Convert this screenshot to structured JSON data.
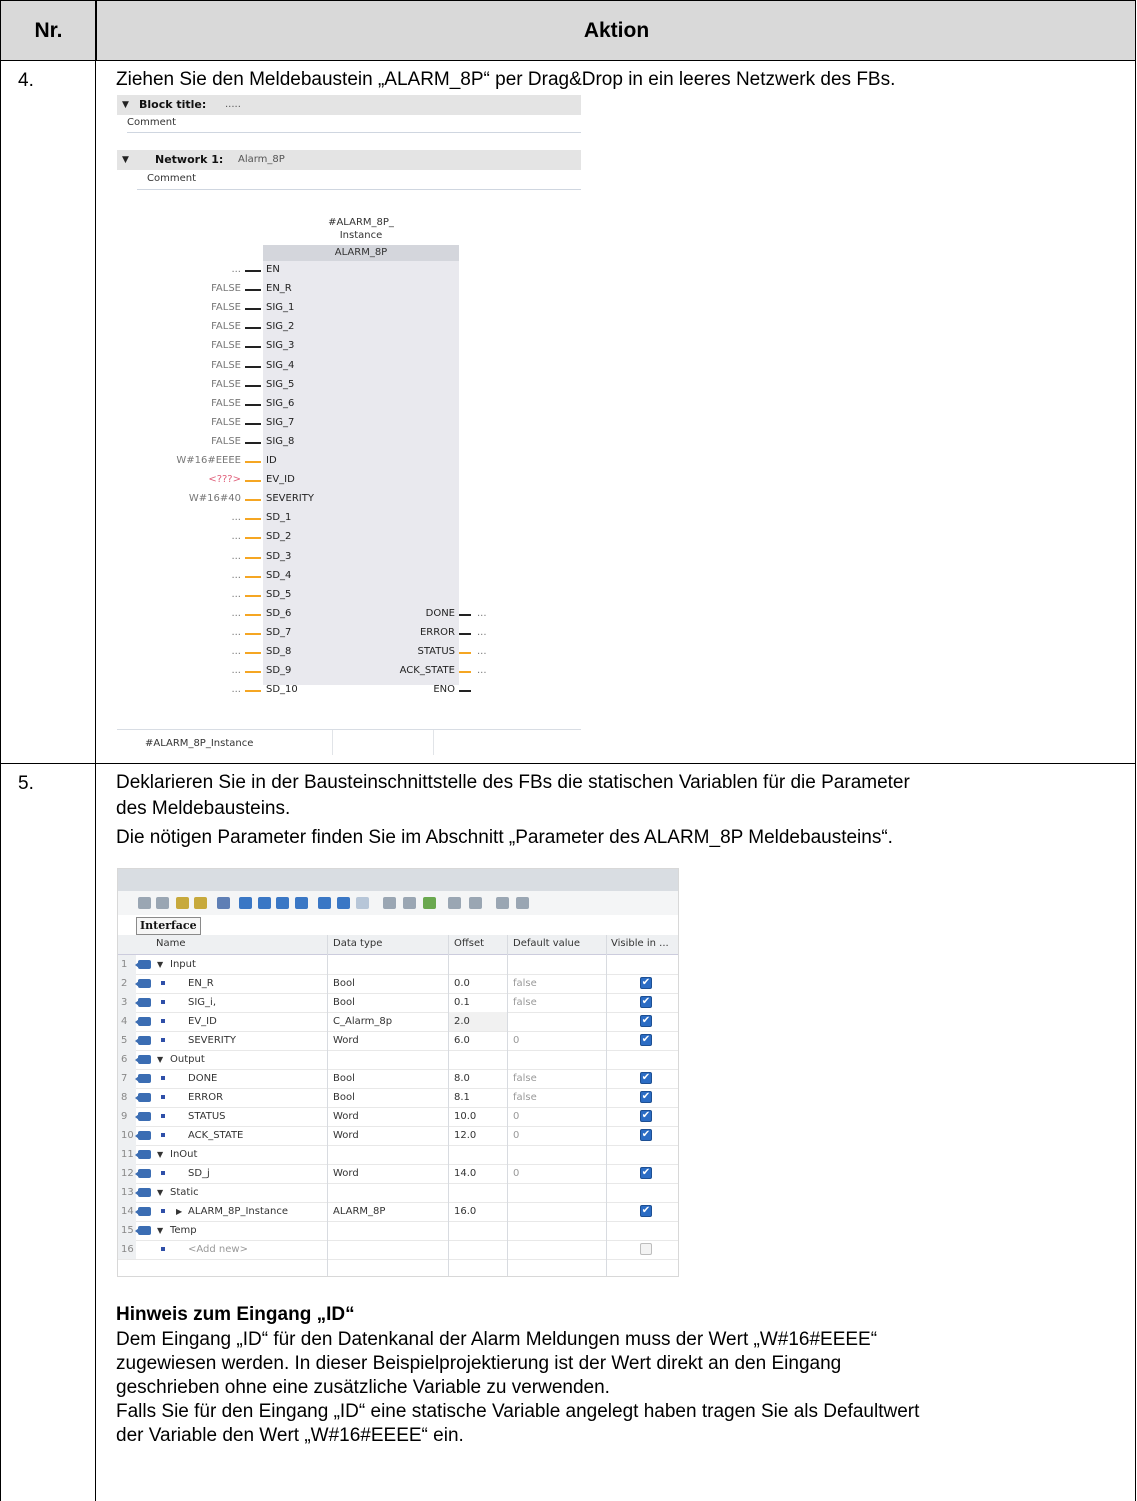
{
  "table": {
    "header_nr": "Nr.",
    "header_action": "Aktion"
  },
  "step4": {
    "nr": "4.",
    "text": "Ziehen Sie den Meldebaustein „ALARM_8P“ per Drag&Drop in ein leeres Netzwerk des FBs.",
    "editor": {
      "block_title_label": "Block title:",
      "block_title_value": ".....",
      "comment1": "Comment",
      "network_label": "Network 1:",
      "network_name": "Alarm_8P",
      "comment2": "Comment",
      "instance_line1": "#ALARM_8P_",
      "instance_line2": "Instance",
      "block_name": "ALARM_8P",
      "inputs": [
        {
          "value": "...",
          "pin": "EN",
          "wire": "black"
        },
        {
          "value": "FALSE",
          "pin": "EN_R",
          "wire": "black"
        },
        {
          "value": "FALSE",
          "pin": "SIG_1",
          "wire": "black"
        },
        {
          "value": "FALSE",
          "pin": "SIG_2",
          "wire": "black"
        },
        {
          "value": "FALSE",
          "pin": "SIG_3",
          "wire": "black"
        },
        {
          "value": "FALSE",
          "pin": "SIG_4",
          "wire": "black"
        },
        {
          "value": "FALSE",
          "pin": "SIG_5",
          "wire": "black"
        },
        {
          "value": "FALSE",
          "pin": "SIG_6",
          "wire": "black"
        },
        {
          "value": "FALSE",
          "pin": "SIG_7",
          "wire": "black"
        },
        {
          "value": "FALSE",
          "pin": "SIG_8",
          "wire": "black"
        },
        {
          "value": "W#16#EEEE",
          "pin": "ID",
          "wire": "orange"
        },
        {
          "value": "<???>",
          "pin": "EV_ID",
          "wire": "orange"
        },
        {
          "value": "W#16#40",
          "pin": "SEVERITY",
          "wire": "orange"
        },
        {
          "value": "...",
          "pin": "SD_1",
          "wire": "orange"
        },
        {
          "value": "...",
          "pin": "SD_2",
          "wire": "orange"
        },
        {
          "value": "...",
          "pin": "SD_3",
          "wire": "orange"
        },
        {
          "value": "...",
          "pin": "SD_4",
          "wire": "orange"
        },
        {
          "value": "...",
          "pin": "SD_5",
          "wire": "orange"
        },
        {
          "value": "...",
          "pin": "SD_6",
          "wire": "orange"
        },
        {
          "value": "...",
          "pin": "SD_7",
          "wire": "orange"
        },
        {
          "value": "...",
          "pin": "SD_8",
          "wire": "orange"
        },
        {
          "value": "...",
          "pin": "SD_9",
          "wire": "orange"
        },
        {
          "value": "...",
          "pin": "SD_10",
          "wire": "orange"
        }
      ],
      "outputs": [
        {
          "pin": "DONE",
          "value": "...",
          "wire": "black"
        },
        {
          "pin": "ERROR",
          "value": "...",
          "wire": "black"
        },
        {
          "pin": "STATUS",
          "value": "...",
          "wire": "orange"
        },
        {
          "pin": "ACK_STATE",
          "value": "...",
          "wire": "orange"
        },
        {
          "pin": "ENO",
          "value": "",
          "wire": "black"
        }
      ],
      "footer_instance": "#ALARM_8P_Instance"
    }
  },
  "step5": {
    "nr": "5.",
    "text1": "Deklarieren Sie in der Bausteinschnittstelle des FBs die statischen Variablen für die Parameter",
    "text2": "des Meldebausteins.",
    "text3": "Die nötigen Parameter finden Sie im Abschnitt „Parameter des ALARM_8P Meldebausteins“.",
    "interface": {
      "tab": "Interface",
      "columns": [
        "Name",
        "Data type",
        "Offset",
        "Default value",
        "Visible in ..."
      ],
      "rows": [
        {
          "n": "1",
          "level": 0,
          "toggle": "▼",
          "name": "Input",
          "type": "",
          "offset": "",
          "default": "",
          "visible": null
        },
        {
          "n": "2",
          "level": 1,
          "toggle": "",
          "name": "EN_R",
          "type": "Bool",
          "offset": "0.0",
          "default": "false",
          "visible": true
        },
        {
          "n": "3",
          "level": 1,
          "toggle": "",
          "name": "SIG_i,",
          "type": "Bool",
          "offset": "0.1",
          "default": "false",
          "visible": true
        },
        {
          "n": "4",
          "level": 1,
          "toggle": "",
          "name": "EV_ID",
          "type": "C_Alarm_8p",
          "offset": "2.0",
          "default": "",
          "visible": true,
          "shaded": true
        },
        {
          "n": "5",
          "level": 1,
          "toggle": "",
          "name": "SEVERITY",
          "type": "Word",
          "offset": "6.0",
          "default": "0",
          "visible": true
        },
        {
          "n": "6",
          "level": 0,
          "toggle": "▼",
          "name": "Output",
          "type": "",
          "offset": "",
          "default": "",
          "visible": null
        },
        {
          "n": "7",
          "level": 1,
          "toggle": "",
          "name": "DONE",
          "type": "Bool",
          "offset": "8.0",
          "default": "false",
          "visible": true
        },
        {
          "n": "8",
          "level": 1,
          "toggle": "",
          "name": "ERROR",
          "type": "Bool",
          "offset": "8.1",
          "default": "false",
          "visible": true
        },
        {
          "n": "9",
          "level": 1,
          "toggle": "",
          "name": "STATUS",
          "type": "Word",
          "offset": "10.0",
          "default": "0",
          "visible": true
        },
        {
          "n": "10",
          "level": 1,
          "toggle": "",
          "name": "ACK_STATE",
          "type": "Word",
          "offset": "12.0",
          "default": "0",
          "visible": true
        },
        {
          "n": "11",
          "level": 0,
          "toggle": "▼",
          "name": "InOut",
          "type": "",
          "offset": "",
          "default": "",
          "visible": null
        },
        {
          "n": "12",
          "level": 1,
          "toggle": "",
          "name": "SD_j",
          "type": "Word",
          "offset": "14.0",
          "default": "0",
          "visible": true
        },
        {
          "n": "13",
          "level": 0,
          "toggle": "▼",
          "name": "Static",
          "type": "",
          "offset": "",
          "default": "",
          "visible": null
        },
        {
          "n": "14",
          "level": 1,
          "toggle": "▶",
          "name": "ALARM_8P_Instance",
          "type": "ALARM_8P",
          "offset": "16.0",
          "default": "",
          "visible": true
        },
        {
          "n": "15",
          "level": 0,
          "toggle": "▼",
          "name": "Temp",
          "type": "",
          "offset": "",
          "default": "",
          "visible": null
        },
        {
          "n": "16",
          "level": 1,
          "toggle": "",
          "name": "<Add new>",
          "type": "",
          "offset": "",
          "default": "",
          "visible": false,
          "placeholder": true
        }
      ]
    },
    "note_title": "Hinweis zum Eingang „ID“",
    "note1": "Dem Eingang „ID“ für den Datenkanal der Alarm Meldungen muss der Wert „W#16#EEEE“",
    "note2": "zugewiesen werden. In dieser Beispielprojektierung ist der Wert direkt an den Eingang",
    "note3": "geschrieben ohne eine zusätzliche Variable zu verwenden.",
    "note4": "Falls Sie für den Eingang „ID“ eine statische Variable angelegt haben tragen Sie als Defaultwert",
    "note5": "der Variable den Wert „W#16#EEEE“ ein."
  },
  "colors": {
    "header_bg": "#d9d9d9",
    "wire_orange": "#f5a623",
    "checkbox_blue": "#2b6cc4",
    "invalid_red": "#e0607a"
  }
}
